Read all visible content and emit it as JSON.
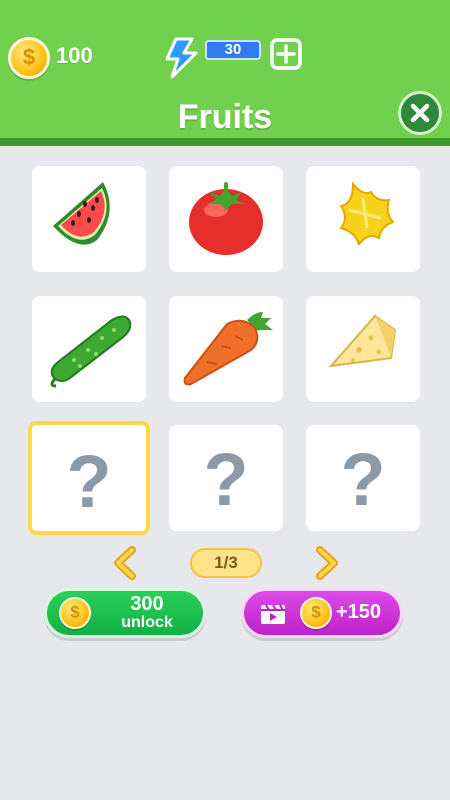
{
  "header": {
    "coins": "100",
    "energy": "30",
    "title": "Fruits"
  },
  "grid": {
    "items": [
      {
        "name": "watermelon",
        "locked": false
      },
      {
        "name": "tomato",
        "locked": false
      },
      {
        "name": "starfruit",
        "locked": false
      },
      {
        "name": "cucumber",
        "locked": false
      },
      {
        "name": "carrot",
        "locked": false
      },
      {
        "name": "cheese",
        "locked": false
      },
      {
        "name": "locked",
        "locked": true,
        "label": "?",
        "selected": true
      },
      {
        "name": "locked",
        "locked": true,
        "label": "?"
      },
      {
        "name": "locked",
        "locked": true,
        "label": "?"
      }
    ]
  },
  "pager": {
    "page": "1/3"
  },
  "actions": {
    "unlock_price": "300",
    "unlock_label": "unlock",
    "video_reward": "+150"
  },
  "colors": {
    "header_green": "#72d04f",
    "unlock_green": "#13b042",
    "video_purple": "#bb22c8",
    "energy_blue": "#2f7cf0",
    "selected_border": "#ffd84a"
  }
}
